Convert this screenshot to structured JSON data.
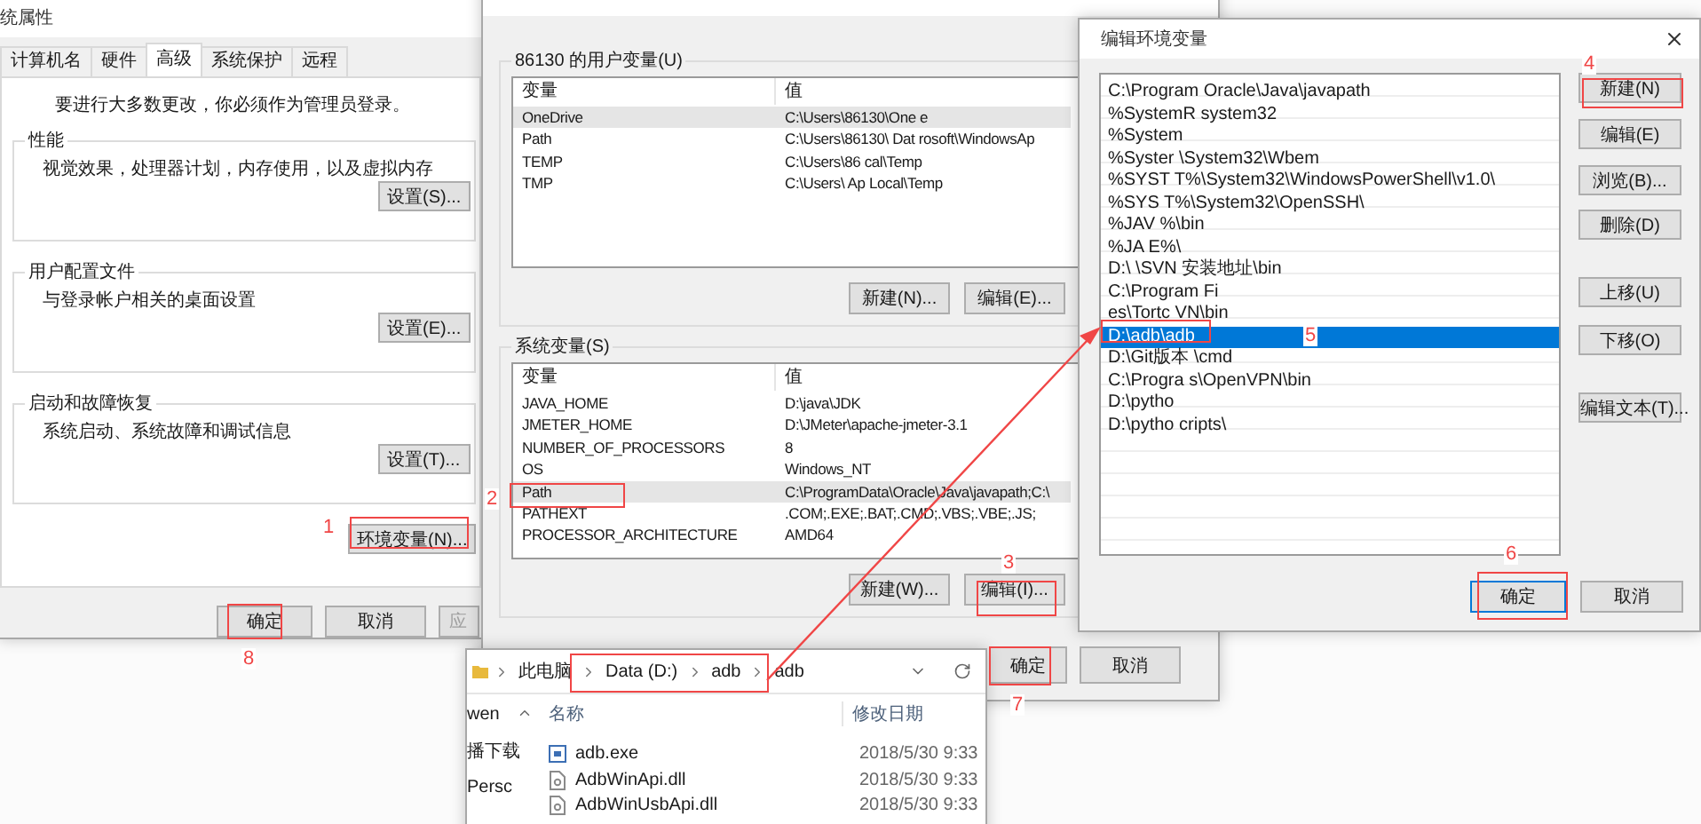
{
  "system_properties": {
    "title": "统属性",
    "tabs": [
      {
        "label": "计算机名",
        "selected": false
      },
      {
        "label": "硬件",
        "selected": false
      },
      {
        "label": "高级",
        "selected": true
      },
      {
        "label": "系统保护",
        "selected": false
      },
      {
        "label": "远程",
        "selected": false
      }
    ],
    "notice": "要进行大多数更改，你必须作为管理员登录。",
    "groups": [
      {
        "legend": "性能",
        "description": "视觉效果，处理器计划，内存使用，以及虚拟内存",
        "button": "设置(S)..."
      },
      {
        "legend": "用户配置文件",
        "description": "与登录帐户相关的桌面设置",
        "button": "设置(E)..."
      },
      {
        "legend": "启动和故障恢复",
        "description": "系统启动、系统故障和调试信息",
        "button": "设置(T)..."
      }
    ],
    "env_button": "环境变量(N)...",
    "buttons": [
      {
        "label": "确定",
        "disabled": false
      },
      {
        "label": "取消",
        "disabled": false
      },
      {
        "label": "应",
        "disabled": true
      }
    ]
  },
  "environment_variables": {
    "user_group": {
      "legend": "86130 的用户变量(U)",
      "columns": [
        "变量",
        "值"
      ],
      "rows": [
        {
          "name": "OneDrive",
          "value": "C:\\Users\\86130\\One e",
          "selected": true
        },
        {
          "name": "Path",
          "value": "C:\\Users\\86130\\ Dat rosoft\\WindowsAp",
          "selected": false
        },
        {
          "name": "TEMP",
          "value": "C:\\Users\\86 cal\\Temp",
          "selected": false
        },
        {
          "name": "TMP",
          "value": "C:\\Users\\ Ap Local\\Temp",
          "selected": false
        }
      ],
      "buttons": [
        "新建(N)...",
        "编辑(E)..."
      ]
    },
    "system_group": {
      "legend": "系统变量(S)",
      "columns": [
        "变量",
        "值"
      ],
      "rows": [
        {
          "name": "JAVA_HOME",
          "value": "D:\\java\\JDK",
          "selected": false
        },
        {
          "name": "JMETER_HOME",
          "value": "D:\\JMeter\\apache-jmeter-3.1",
          "selected": false
        },
        {
          "name": "NUMBER_OF_PROCESSORS",
          "value": "8",
          "selected": false
        },
        {
          "name": "OS",
          "value": "Windows_NT",
          "selected": false
        },
        {
          "name": "Path",
          "value": "C:\\ProgramData\\Oracle\\Java\\javapath;C:\\",
          "selected": true
        },
        {
          "name": "PATHEXT",
          "value": ".COM;.EXE;.BAT;.CMD;.VBS;.VBE;.JS;",
          "selected": false
        },
        {
          "name": "PROCESSOR_ARCHITECTURE",
          "value": "AMD64",
          "selected": false
        }
      ],
      "buttons": [
        "新建(W)...",
        "编辑(I)..."
      ]
    },
    "buttons": [
      "确定",
      "取消"
    ]
  },
  "edit_environment_variable": {
    "title": "编辑环境变量",
    "items": [
      {
        "text": "C:\\Program Oracle\\Java\\javapath",
        "selected": false
      },
      {
        "text": "%SystemR system32",
        "selected": false
      },
      {
        "text": "%System",
        "selected": false
      },
      {
        "text": "%Syster \\System32\\Wbem",
        "selected": false
      },
      {
        "text": "%SYST T%\\System32\\WindowsPowerShell\\v1.0\\",
        "selected": false
      },
      {
        "text": "%SYS T%\\System32\\OpenSSH\\",
        "selected": false
      },
      {
        "text": "%JAV %\\bin",
        "selected": false
      },
      {
        "text": "%JA E%\\",
        "selected": false
      },
      {
        "text": "D:\\ \\SVN 安装地址\\bin",
        "selected": false
      },
      {
        "text": "C:\\Program Fi",
        "selected": false
      },
      {
        "text": "es\\Tortc VN\\bin",
        "selected": false
      },
      {
        "text": "D:\\adb\\adb",
        "selected": true
      },
      {
        "text": "D:\\Git版本 \\cmd",
        "selected": false
      },
      {
        "text": "C:\\Progra s\\OpenVPN\\bin",
        "selected": false
      },
      {
        "text": "D:\\pytho",
        "selected": false
      },
      {
        "text": "D:\\pytho cripts\\",
        "selected": false
      }
    ],
    "buttons": [
      "新建(N)",
      "编辑(E)",
      "浏览(B)...",
      "删除(D)",
      "上移(U)",
      "下移(O)",
      "编辑文本(T)..."
    ],
    "footer_buttons": [
      "确定",
      "取消"
    ]
  },
  "explorer": {
    "breadcrumb": [
      "此电脑",
      "Data (D:)",
      "adb",
      "adb"
    ],
    "nav": [
      "wen",
      "播下载",
      "Persc"
    ],
    "columns": [
      "名称",
      "修改日期"
    ],
    "files": [
      {
        "name": "adb.exe",
        "date": "2018/5/30 9:33",
        "kind": "exe"
      },
      {
        "name": "AdbWinApi.dll",
        "date": "2018/5/30 9:33",
        "kind": "dll"
      },
      {
        "name": "AdbWinUsbApi.dll",
        "date": "2018/5/30 9:33",
        "kind": "dll"
      }
    ]
  },
  "annotations": [
    "1",
    "2",
    "3",
    "4",
    "5",
    "6",
    "7",
    "8"
  ]
}
